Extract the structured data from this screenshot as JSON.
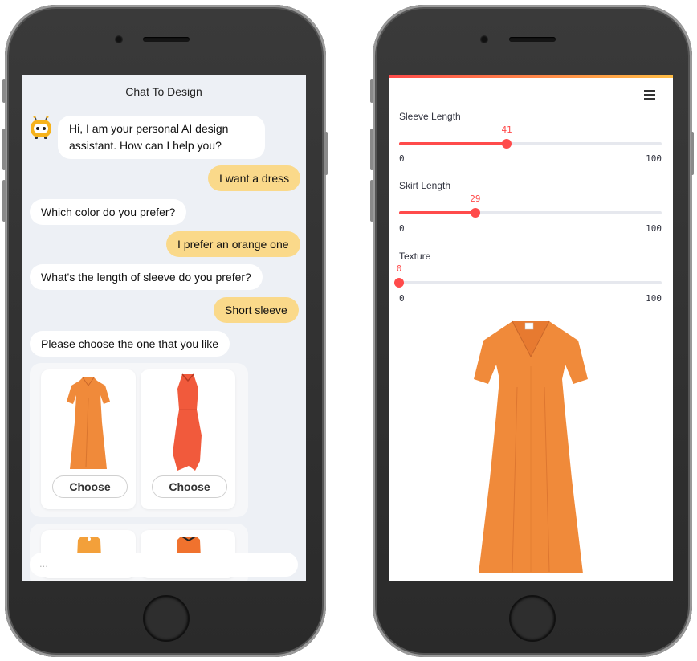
{
  "left_screen": {
    "header_title": "Chat To Design",
    "messages": [
      {
        "from": "bot",
        "text": "Hi, I am your personal AI design assistant. How can I help you?"
      },
      {
        "from": "user",
        "text": "I want a dress"
      },
      {
        "from": "bot",
        "text": "Which color do you prefer?"
      },
      {
        "from": "user",
        "text": "I prefer an orange one"
      },
      {
        "from": "bot",
        "text": "What's the length of sleeve do you prefer?"
      },
      {
        "from": "user",
        "text": "Short sleeve"
      },
      {
        "from": "bot",
        "text": "Please choose the one that you like"
      }
    ],
    "cards": [
      {
        "button_label": "Choose",
        "image": "orange-dress-short-sleeve"
      },
      {
        "button_label": "Choose",
        "image": "orange-red-sleeveless-dress"
      }
    ],
    "input_placeholder": "..."
  },
  "right_screen": {
    "menu_icon": "hamburger-menu-icon",
    "sliders": [
      {
        "label": "Sleeve Length",
        "value": "41",
        "min": "0",
        "max": "100",
        "fraction": 0.41
      },
      {
        "label": "Skirt Length",
        "value": "29",
        "min": "0",
        "max": "100",
        "fraction": 0.29
      },
      {
        "label": "Texture",
        "value": "0",
        "min": "0",
        "max": "100",
        "fraction": 0.0
      }
    ],
    "image": "orange-dress-result"
  },
  "colors": {
    "accent": "#ff4b4b",
    "user_bubble": "#fad98a",
    "chat_bg": "#edf0f5",
    "dress_orange": "#f08a3a"
  }
}
